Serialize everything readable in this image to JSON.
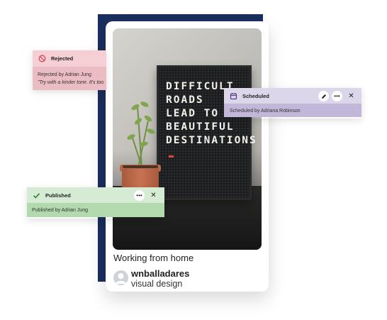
{
  "post": {
    "image_text": "DIFFICULT\nROADS\nLEAD TO\nBEAUTIFUL\nDESTINATIONS",
    "caption": "Working from home",
    "author": {
      "name": "wnballadares",
      "role": "visual design"
    }
  },
  "statuses": {
    "rejected": {
      "icon": "no-entry-icon",
      "title": "Rejected",
      "detail": "Rejected by Adrian Jung",
      "comment": "\"Try with a kinder tone. It's too",
      "color": "#f5cfd4"
    },
    "scheduled": {
      "icon": "calendar-icon",
      "title": "Scheduled",
      "detail": "Scheduled by Adriana Robinson",
      "actions": [
        "edit-icon",
        "more-icon",
        "close-icon"
      ],
      "color": "#dcd6ea"
    },
    "published": {
      "icon": "checkmark-icon",
      "title": "Published",
      "detail": "Published by Adrian Jung",
      "actions": [
        "more-icon",
        "close-icon"
      ],
      "color": "#d5ebd3"
    }
  },
  "colors": {
    "navy": "#1b2f5e",
    "rejected_accent": "#d9475a"
  }
}
